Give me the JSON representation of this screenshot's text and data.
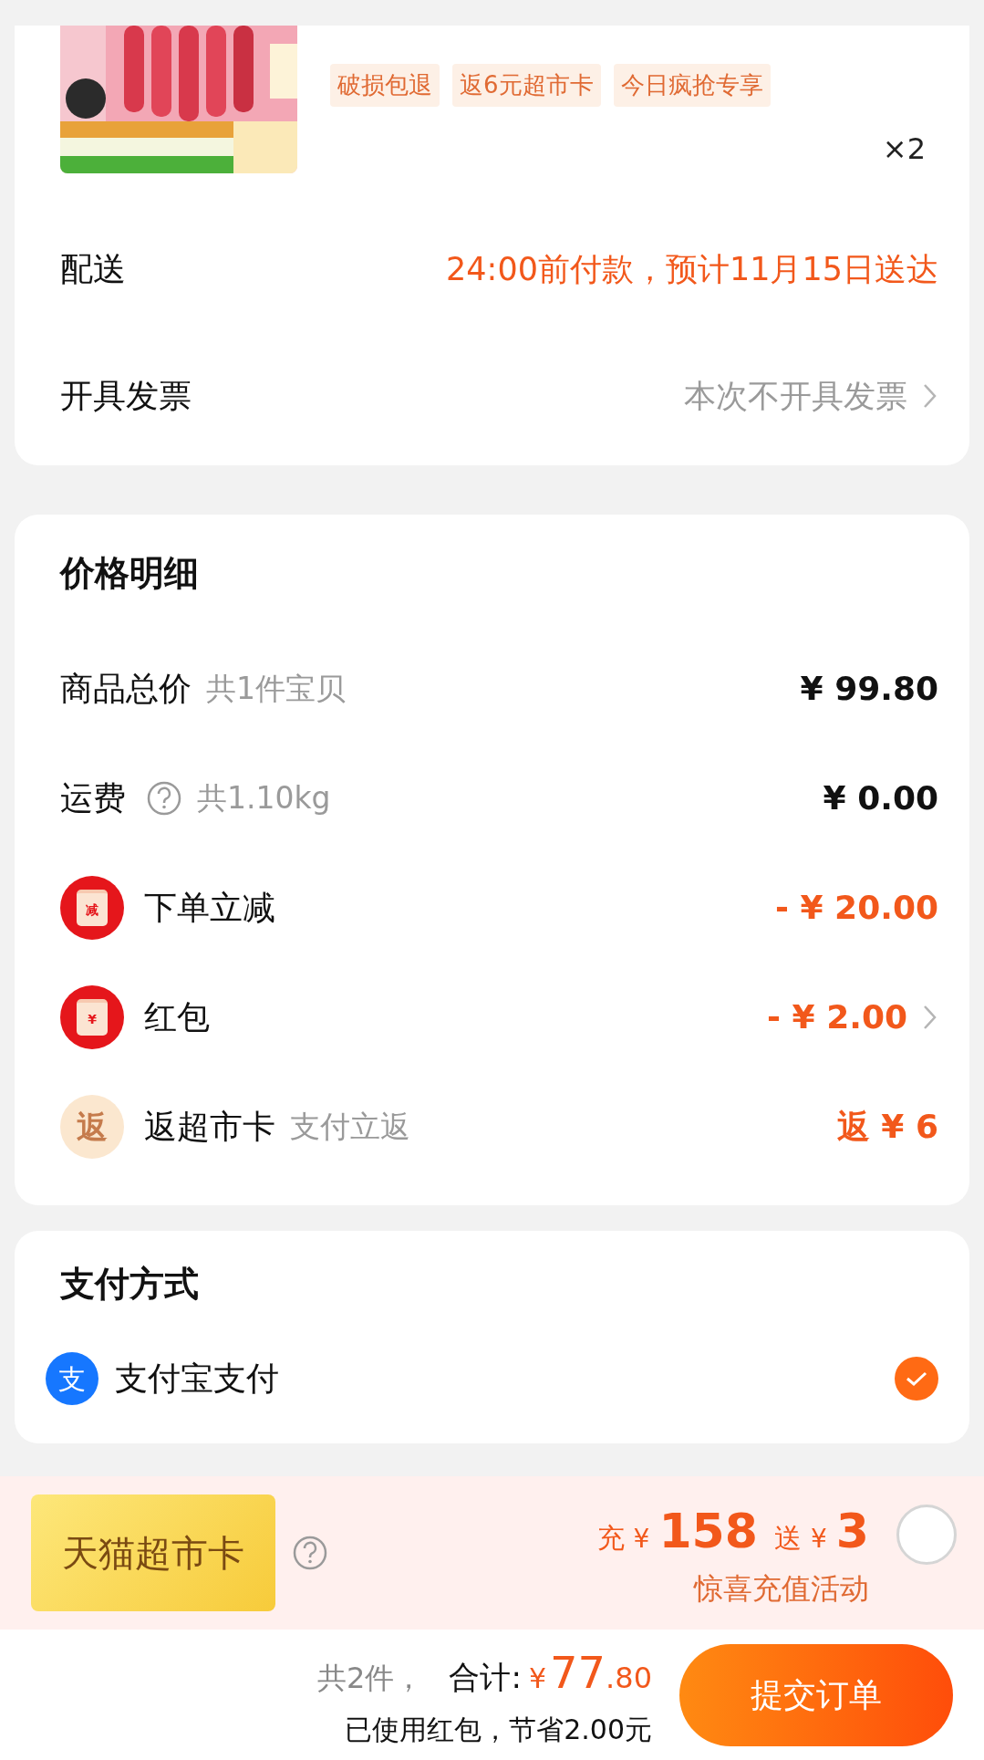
{
  "product": {
    "tags": [
      "破损包退",
      "返6元超市卡",
      "今日疯抢专享"
    ],
    "quantity": "×2"
  },
  "delivery": {
    "label": "配送",
    "value": "24:00前付款，预计11月15日送达"
  },
  "invoice": {
    "label": "开具发票",
    "value": "本次不开具发票"
  },
  "price_detail": {
    "title": "价格明细",
    "rows": [
      {
        "kind": "plain",
        "label": "商品总价",
        "sub": "共1件宝贝",
        "value": "¥ 99.80",
        "highlight": false,
        "has_arrow": false
      },
      {
        "kind": "help",
        "label": "运费",
        "sub": "共1.10kg",
        "value": "¥ 0.00",
        "highlight": false,
        "has_arrow": false
      },
      {
        "kind": "envelope",
        "badge": "减",
        "label": "下单立减",
        "value": "- ¥ 20.00",
        "highlight": true,
        "has_arrow": false
      },
      {
        "kind": "envelope",
        "badge": "¥",
        "label": "红包",
        "value": "- ¥ 2.00",
        "highlight": true,
        "has_arrow": true
      },
      {
        "kind": "rebate",
        "badge": "返",
        "label": "返超市卡",
        "sub": "支付立返",
        "value": "返 ¥ 6",
        "highlight": true,
        "has_arrow": false
      }
    ]
  },
  "payment": {
    "title": "支付方式",
    "methods": [
      {
        "badge": "支",
        "label": "支付宝支付",
        "selected": true
      }
    ]
  },
  "promo": {
    "card": "天猫超市卡",
    "charge_label": "充",
    "charge_currency": "¥",
    "charge_amount": "158",
    "bonus_label": "送",
    "bonus_currency": "¥",
    "bonus_amount": "3",
    "caption": "惊喜充值活动",
    "selected": false
  },
  "footer": {
    "count": "共2件，",
    "total_label": "合计:",
    "currency": "¥",
    "total_int": "77",
    "total_dec": ".80",
    "saving": "已使用红包，节省2.00元",
    "submit": "提交订单"
  }
}
